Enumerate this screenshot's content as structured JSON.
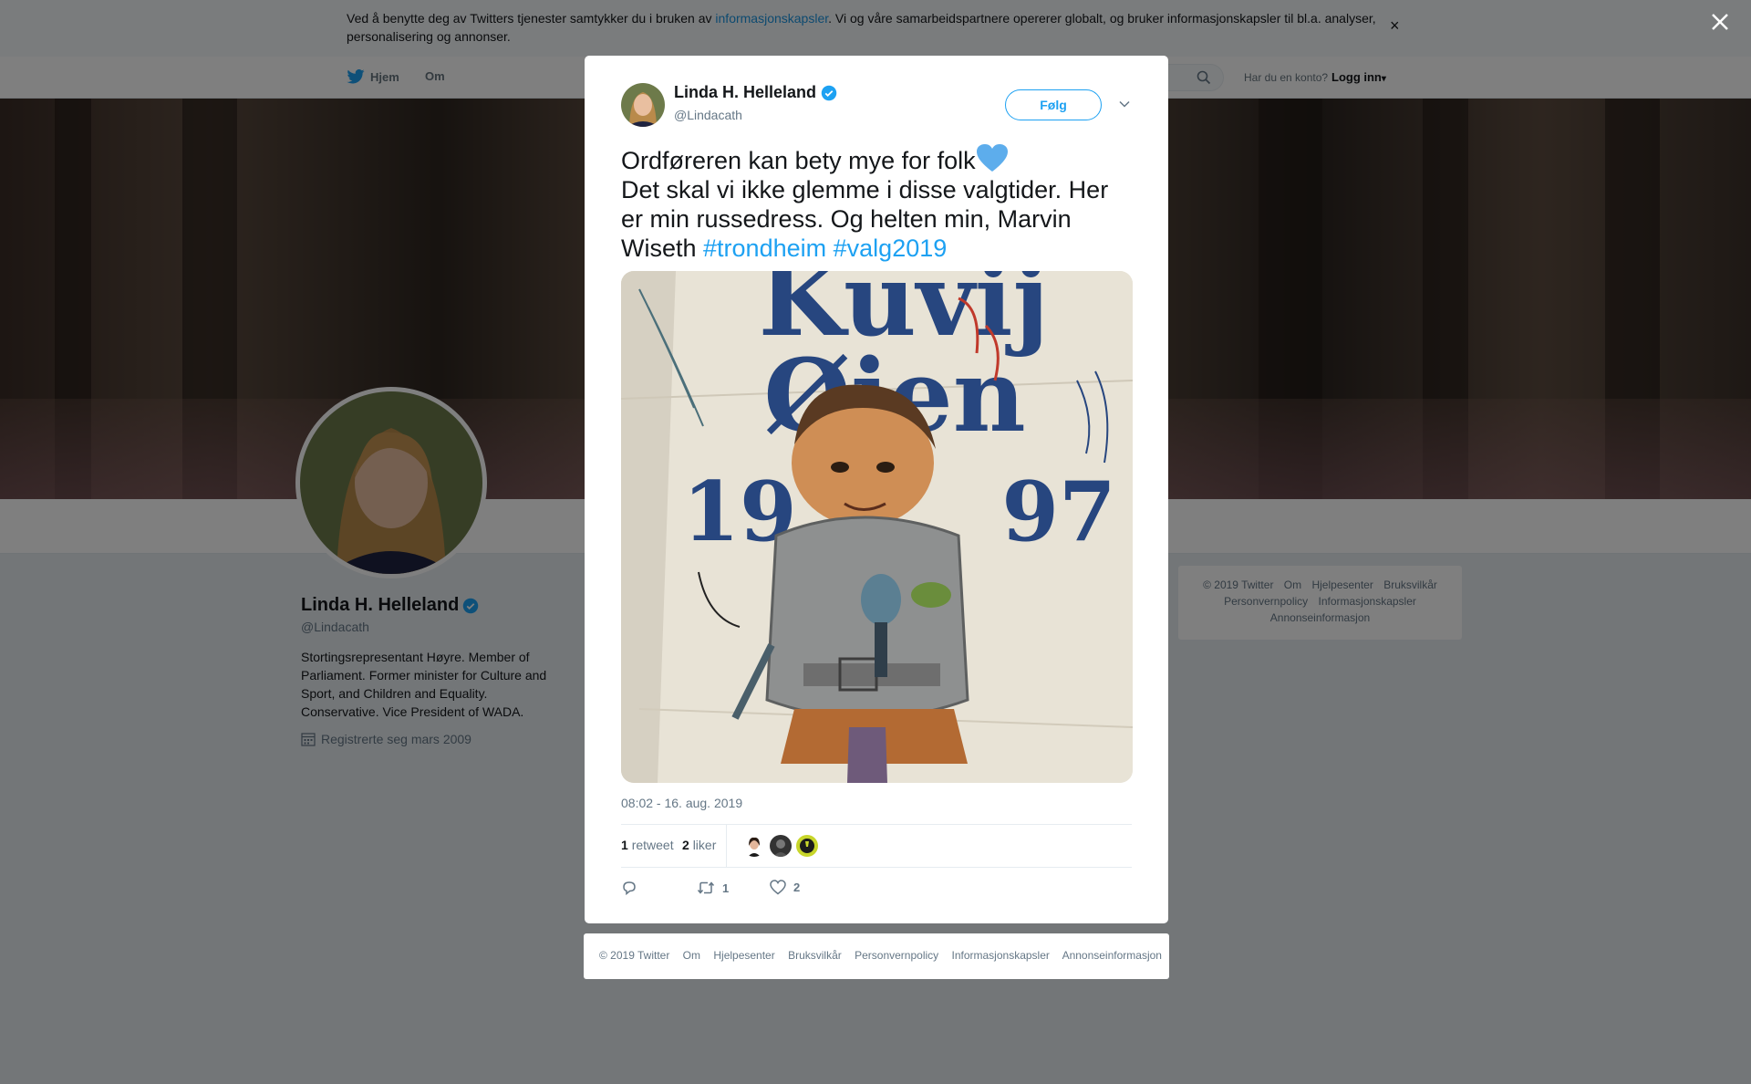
{
  "cookie_bar": {
    "text_before": "Ved å benytte deg av Twitters tjenester samtykker du i bruken av ",
    "link": "informasjonskapsler",
    "text_after": ". Vi og våre samarbeidspartnere opererer globalt, og bruker informasjonskapsler til bl.a. analyser, personalisering og annonser.",
    "close": "×"
  },
  "topnav": {
    "home": "Hjem",
    "about": "Om",
    "login_question": "Har du en konto?",
    "login": "Logg inn",
    "caret": "▾"
  },
  "profile": {
    "name": "Linda H. Helleland",
    "handle": "@Lindacath",
    "bio": "Stortingsrepresentant Høyre. Member of Parliament. Former minister for Culture and Sport, and Children and Equality. Conservative. Vice President of WADA.",
    "joined": "Registrerte seg mars 2009"
  },
  "right_footer": {
    "links": [
      "© 2019 Twitter",
      "Om",
      "Hjelpesenter",
      "Bruksvilkår",
      "Personvernpolicy",
      "Informasjonskapsler",
      "Annonseinformasjon"
    ]
  },
  "tweet": {
    "author_name": "Linda H. Helleland",
    "author_handle": "@Lindacath",
    "follow_label": "Følg",
    "text_line1": "Ordføreren kan bety mye for folk",
    "text_line2": "Det skal vi ikke glemme i disse valgtider. Her er min russedress. Og helten min, Marvin Wiseth ",
    "hashtag1": "#trondheim",
    "hashtag2": "#valg2019",
    "timestamp": "08:02 - 16. aug. 2019",
    "retweets_count": "1",
    "retweets_label": "retweet",
    "likes_count": "2",
    "likes_label": "liker",
    "action_retweet_count": "1",
    "action_like_count": "2",
    "image": {
      "banner_text_1": "Kuvij",
      "banner_text_2": "Øien",
      "year_left": "19",
      "year_right": "97"
    }
  },
  "modal_footer": {
    "links": [
      "© 2019 Twitter",
      "Om",
      "Hjelpesenter",
      "Bruksvilkår",
      "Personvernpolicy",
      "Informasjonskapsler",
      "Annonseinformasjon"
    ]
  },
  "colors": {
    "accent": "#1da1f2",
    "overlay": "rgba(0,0,0,0.5)",
    "verified": "#1da1f2"
  },
  "icons": [
    "twitter-bird-icon",
    "search-icon",
    "verified-badge-icon",
    "chevron-down-icon",
    "calendar-icon",
    "reply-icon",
    "retweet-icon",
    "heart-icon",
    "close-icon",
    "blue-heart-emoji"
  ]
}
